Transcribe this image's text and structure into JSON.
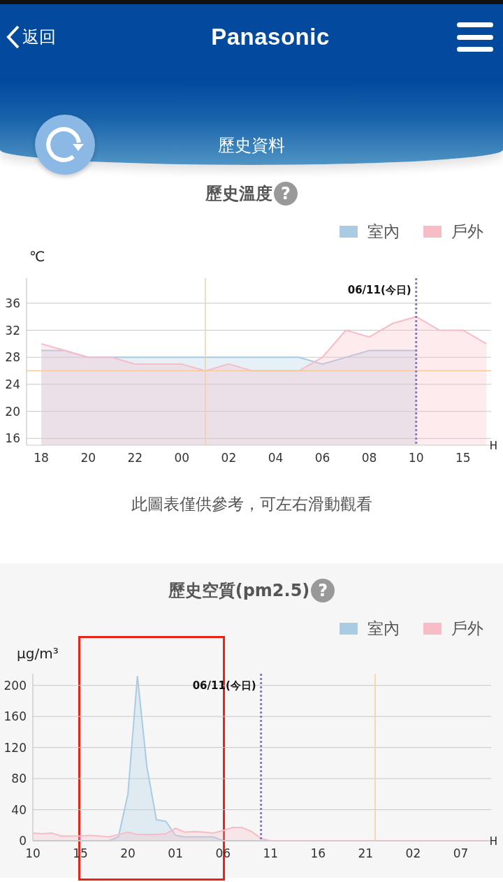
{
  "header": {
    "back_label": "返回",
    "brand": "Panasonic",
    "page_title": "歷史資料"
  },
  "temperature": {
    "help_mark": "?",
    "note": "此圖表僅供參考，可左右滑動觀看",
    "chart_data": {
      "type": "area",
      "title": "歷史溫度",
      "ylabel": "℃",
      "xlabel": "H",
      "categories": [
        "18",
        null,
        "20",
        null,
        "22",
        null,
        "00",
        null,
        "02",
        null,
        "04",
        null,
        "06",
        null,
        "08",
        null,
        "10",
        null,
        "15",
        null
      ],
      "series": [
        {
          "name": "室內",
          "color": "#a9cce3",
          "values": [
            29,
            29,
            28,
            28,
            28,
            28,
            28,
            28,
            28,
            28,
            28,
            28,
            27,
            28,
            29,
            29,
            29,
            null,
            null,
            null
          ]
        },
        {
          "name": "戶外",
          "color": "#f7bcc6",
          "values": [
            30,
            29,
            28,
            28,
            27,
            27,
            27,
            26,
            27,
            26,
            26,
            26,
            28,
            32,
            31,
            33,
            34,
            32,
            32,
            30
          ]
        }
      ],
      "ylim": [
        15,
        39.7
      ],
      "yticks": [
        16,
        20,
        24,
        28,
        32,
        36
      ],
      "grid": true,
      "ref_lines": [
        {
          "axis": "y",
          "value": 26
        }
      ],
      "annotations": [
        "06/11(今日)"
      ]
    }
  },
  "pm25": {
    "help_mark": "?",
    "chart_data": {
      "type": "area",
      "title": "歷史空質(pm2.5)",
      "ylabel": "µg/m³",
      "xlabel": "H",
      "categories": [
        "10",
        null,
        null,
        null,
        null,
        "15",
        null,
        null,
        null,
        null,
        "20",
        null,
        null,
        null,
        null,
        "01",
        null,
        null,
        null,
        null,
        "06",
        null,
        null,
        null,
        null,
        "11",
        null,
        null,
        null,
        null,
        "16",
        null,
        null,
        null,
        null,
        "21",
        null,
        null,
        null,
        null,
        "02",
        null,
        null,
        null,
        null,
        "07",
        null,
        null,
        null
      ],
      "series": [
        {
          "name": "室內",
          "color": "#a9cce3",
          "values": [
            0,
            0,
            0,
            0,
            0,
            0,
            0,
            0,
            0,
            5,
            60,
            212,
            95,
            27,
            25,
            7,
            5,
            5,
            5,
            5,
            0,
            0,
            0,
            0,
            0,
            0,
            0,
            0,
            0,
            0,
            0,
            0,
            0,
            0,
            0,
            0,
            0,
            0,
            0,
            0,
            0,
            0,
            0,
            0,
            0,
            0,
            0,
            0,
            0
          ]
        },
        {
          "name": "戶外",
          "color": "#f7bcc6",
          "values": [
            10,
            9,
            10,
            6,
            6,
            6,
            7,
            6,
            5,
            8,
            11,
            8,
            8,
            8,
            9,
            16,
            11,
            12,
            11,
            10,
            13,
            17,
            17,
            12,
            3,
            0,
            0,
            0,
            0,
            0,
            0,
            0,
            0,
            0,
            0,
            0,
            0,
            0,
            0,
            0,
            0,
            0,
            0,
            0,
            0,
            0,
            0,
            0,
            0
          ]
        }
      ],
      "ylim": [
        0,
        215
      ],
      "yticks": [
        0,
        40,
        80,
        120,
        160,
        200
      ],
      "grid": true,
      "annotations": [
        "06/11(今日)"
      ]
    }
  }
}
